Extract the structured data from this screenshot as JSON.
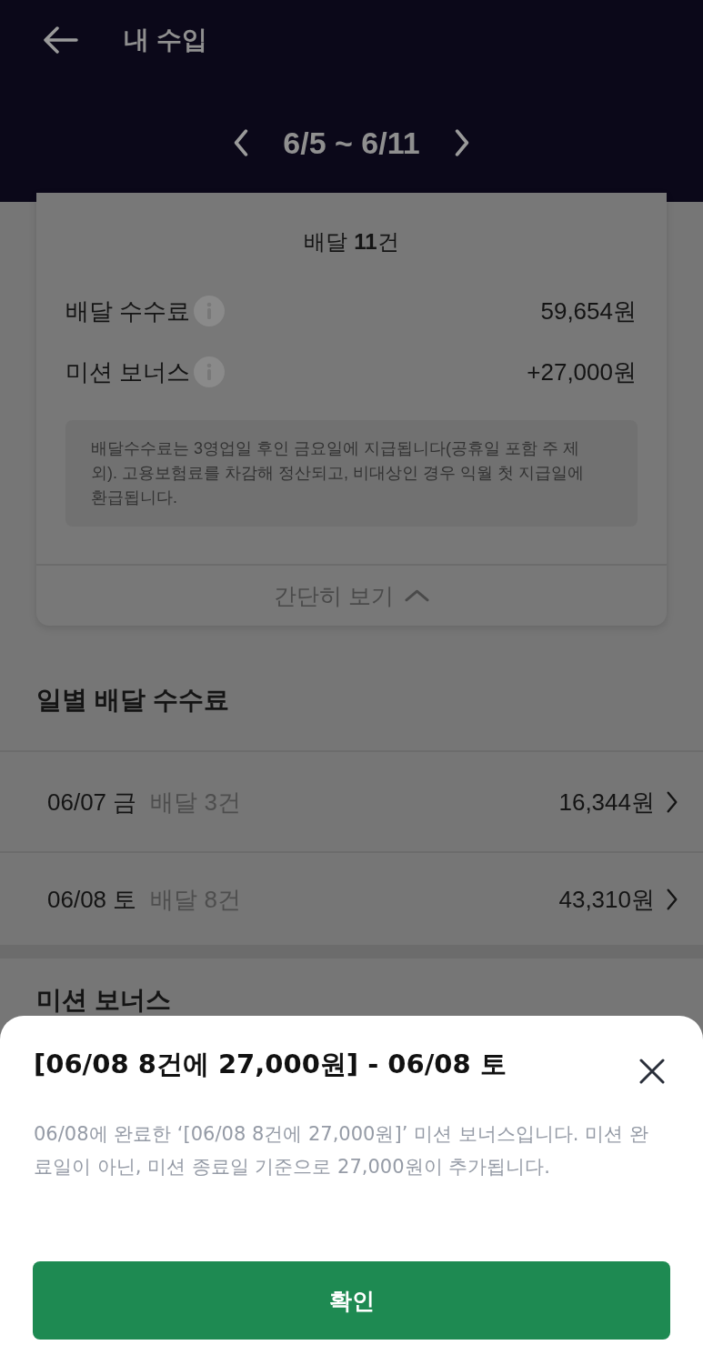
{
  "header": {
    "title": "내 수입"
  },
  "period": {
    "label": "6/5 ~ 6/11"
  },
  "summary": {
    "deliveries": "배달 **11**건",
    "fees": [
      {
        "label": "배달 수수료",
        "amount": "59,654원"
      },
      {
        "label": "미션 보너스",
        "amount": "+27,000원"
      }
    ],
    "note": "배달수수료는 3영업일 후인 금요일에 지급됩니다(공휴일 포함 주 제외). 고용보험료를 차감해 정산되고, 비대상인 경우 익월 첫 지급일에 환급됩니다.",
    "toggle": {
      "label": "간단히 보기",
      "expanded": true
    }
  },
  "daily_fees": {
    "title": "일별 배달 수수료",
    "rows": [
      {
        "date": "06/07 금",
        "deliveries": "배달 3건",
        "amount": "16,344원"
      },
      {
        "date": "06/08 토",
        "deliveries": "배달 8건",
        "amount": "43,310원"
      }
    ]
  },
  "mission_bonus": {
    "title": "미션 보너스"
  },
  "sheet": {
    "title": "[06/08 8건에 27,000원] - 06/08 토",
    "body": "06/08에 완료한 ‘[06/08 8건에 27,000원]’ 미션 보너스입니다. 미션 완료일이 아닌, 미션 종료일 기준으로 27,000원이 추가됩니다.",
    "confirm": "확인"
  }
}
